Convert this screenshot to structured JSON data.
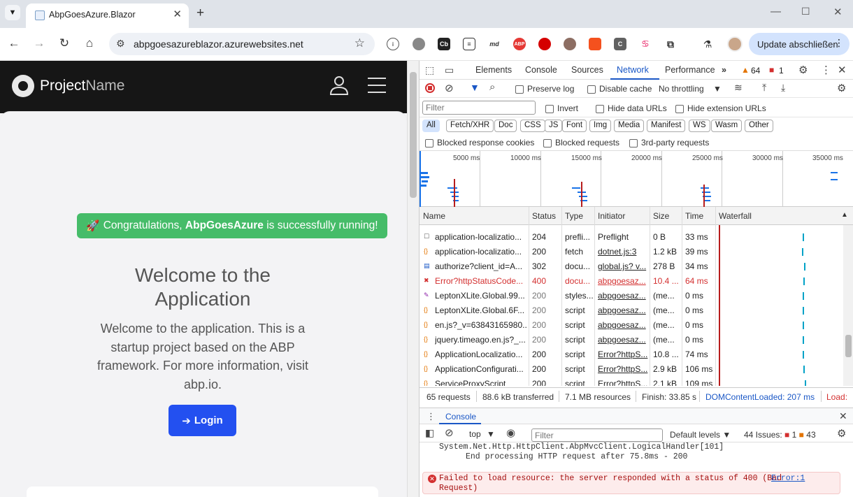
{
  "browser": {
    "tab_title": "AbpGoesAzure.Blazor",
    "url": "abpgoesazureblazor.azurewebsites.net",
    "update_label": "Update abschließen",
    "ext_labels": {
      "cb": "Cb",
      "md": "md",
      "abp": "ABP",
      "c": "C"
    }
  },
  "app": {
    "brand_first": "Project",
    "brand_second": "Name",
    "alert_prefix": "Congratulations, ",
    "alert_bold": "AbpGoesAzure",
    "alert_suffix": " is successfully running!",
    "welcome_title": "Welcome to the Application",
    "welcome_text": "Welcome to the application. This is a startup project based on the ABP framework. For more information, visit abp.io.",
    "login_label": "Login"
  },
  "devtools": {
    "tabs": [
      "Elements",
      "Console",
      "Sources",
      "Network",
      "Performance"
    ],
    "warnings": "64",
    "errors": "1",
    "toolbar": {
      "preserve_log": "Preserve log",
      "disable_cache": "Disable cache",
      "throttling": "No throttling"
    },
    "filter": {
      "placeholder": "Filter",
      "invert": "Invert",
      "hide_data": "Hide data URLs",
      "hide_ext": "Hide extension URLs"
    },
    "chips": [
      "All",
      "Fetch/XHR",
      "Doc",
      "CSS",
      "JS",
      "Font",
      "Img",
      "Media",
      "Manifest",
      "WS",
      "Wasm",
      "Other"
    ],
    "blocked": {
      "cookies": "Blocked response cookies",
      "requests": "Blocked requests",
      "third": "3rd-party requests"
    },
    "timeline_ticks": [
      "5000 ms",
      "10000 ms",
      "15000 ms",
      "20000 ms",
      "25000 ms",
      "30000 ms",
      "35000 ms"
    ],
    "columns": [
      "Name",
      "Status",
      "Type",
      "Initiator",
      "Size",
      "Time",
      "Waterfall"
    ],
    "rows": [
      {
        "name": "application-localizatio...",
        "status": "204",
        "type": "prefli...",
        "initiator": "Preflight",
        "size": "0 B",
        "time": "33 ms"
      },
      {
        "name": "application-localizatio...",
        "status": "200",
        "type": "fetch",
        "initiator": "dotnet.js:3",
        "size": "1.2 kB",
        "time": "39 ms"
      },
      {
        "name": "authorize?client_id=A...",
        "status": "302",
        "type": "docu...",
        "initiator": "global.js? v...",
        "size": "278 B",
        "time": "34 ms"
      },
      {
        "name": "Error?httpStatusCode...",
        "status": "400",
        "type": "docu...",
        "initiator": "abpgoesaz...",
        "size": "10.4 ...",
        "time": "64 ms"
      },
      {
        "name": "LeptonXLite.Global.99...",
        "status": "200",
        "type": "styles...",
        "initiator": "abpgoesaz...",
        "size": "(me...",
        "time": "0 ms"
      },
      {
        "name": "LeptonXLite.Global.6F...",
        "status": "200",
        "type": "script",
        "initiator": "abpgoesaz...",
        "size": "(me...",
        "time": "0 ms"
      },
      {
        "name": "en.js?_v=63843165980...",
        "status": "200",
        "type": "script",
        "initiator": "abpgoesaz...",
        "size": "(me...",
        "time": "0 ms"
      },
      {
        "name": "jquery.timeago.en.js?_...",
        "status": "200",
        "type": "script",
        "initiator": "abpgoesaz...",
        "size": "(me...",
        "time": "0 ms"
      },
      {
        "name": "ApplicationLocalizatio...",
        "status": "200",
        "type": "script",
        "initiator": "Error?httpS...",
        "size": "10.8 ...",
        "time": "74 ms"
      },
      {
        "name": "ApplicationConfigurati...",
        "status": "200",
        "type": "script",
        "initiator": "Error?httpS...",
        "size": "2.9 kB",
        "time": "106 ms"
      },
      {
        "name": "ServiceProxyScript",
        "status": "200",
        "type": "script",
        "initiator": "Error?httpS...",
        "size": "2.1 kB",
        "time": "109 ms"
      }
    ],
    "status_bar": {
      "requests": "65 requests",
      "transferred": "88.6 kB transferred",
      "resources": "7.1 MB resources",
      "finish": "Finish: 33.85 s",
      "dcl": "DOMContentLoaded: 207 ms",
      "load": "Load:"
    },
    "console": {
      "tab": "Console",
      "context": "top",
      "filter_placeholder": "Filter",
      "levels": "Default levels",
      "issues_label": "44 Issues:",
      "issues_err": "1",
      "issues_warn": "43",
      "log_line1": "System.Net.Http.HttpClient.AbpMvcClient.LogicalHandler[101]",
      "log_line2": "End processing HTTP request after 75.8ms - 200",
      "error_text": "Failed to load resource: the server responded with a status of 400 (Bad",
      "error_text2": "Request)",
      "error_link": "Error:1"
    }
  },
  "colors": {
    "accent": "#1a57c6",
    "success": "#46bc69",
    "login": "#2350f0",
    "error": "#d32f2f"
  }
}
